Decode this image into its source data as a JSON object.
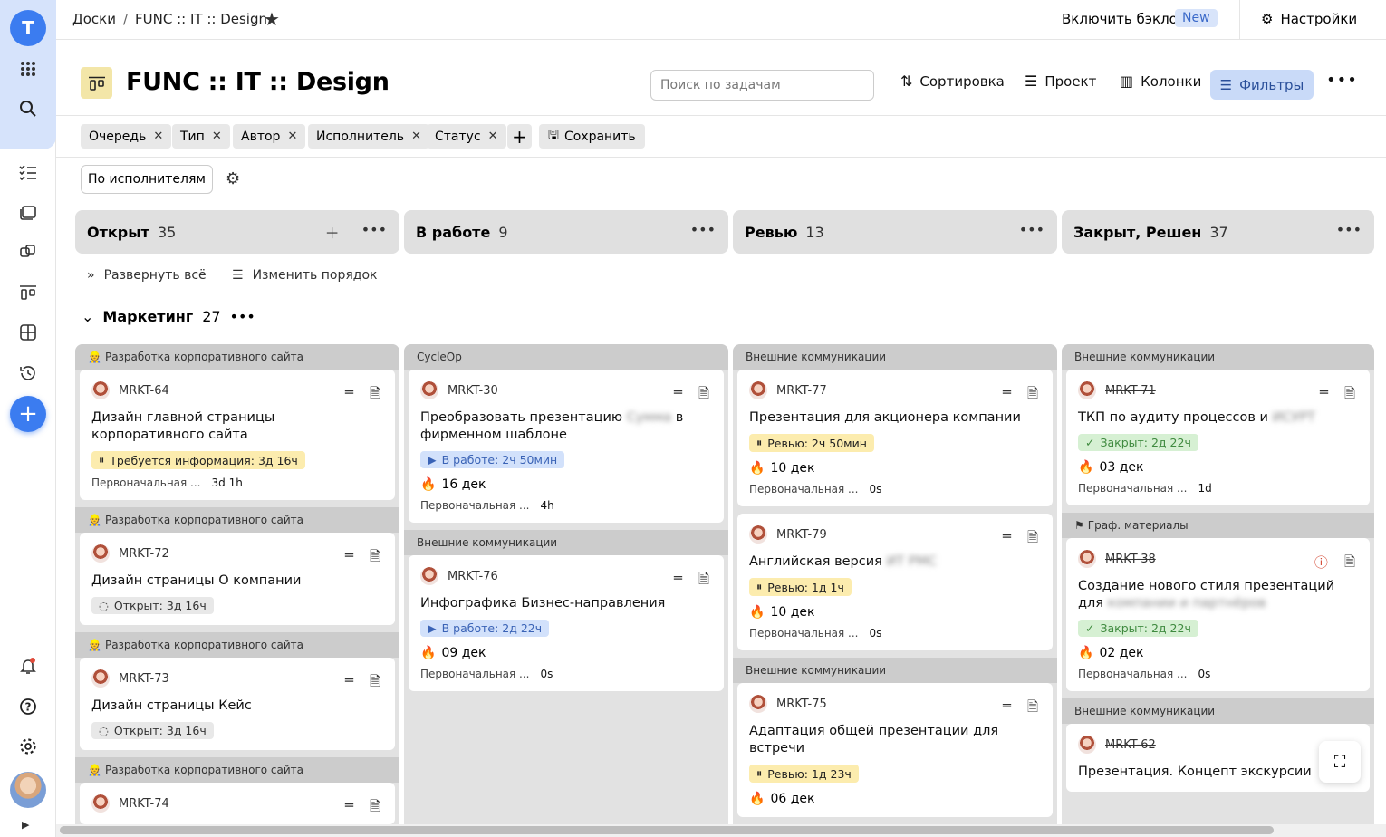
{
  "sidebar": {
    "logo": "T",
    "add_label": "+"
  },
  "breadcrumb": {
    "root": "Доски",
    "current": "FUNC :: IT :: Design"
  },
  "topbar": {
    "backlog_label": "Включить бэклог",
    "new_badge": "New",
    "settings_label": "Настройки"
  },
  "header": {
    "title": "FUNC :: IT :: Design",
    "search_placeholder": "Поиск по задачам",
    "sort_label": "Сортировка",
    "project_label": "Проект",
    "columns_label": "Колонки",
    "filters_label": "Фильтры"
  },
  "filters": {
    "chips": [
      "Очередь",
      "Тип",
      "Автор",
      "Исполнитель",
      "Статус"
    ],
    "save_label": "Сохранить"
  },
  "grouping": {
    "label": "По исполнителям"
  },
  "columns": [
    {
      "name": "Открыт",
      "count": "35"
    },
    {
      "name": "В работе",
      "count": "9"
    },
    {
      "name": "Ревью",
      "count": "13"
    },
    {
      "name": "Закрыт, Решен",
      "count": "37"
    }
  ],
  "toolbar2": {
    "expand_all": "Развернуть всё",
    "reorder": "Изменить порядок"
  },
  "swimlane": {
    "name": "Маркетинг",
    "count": "27"
  },
  "lanes": {
    "open": {
      "cards": [
        {
          "group": "Разработка корпоративного сайта",
          "key": "MRKT-64",
          "title": "Дизайн главной страницы корпоративного сайта",
          "status": "Требуется информация: 3д 16ч",
          "meta_label": "Первоначальная ...",
          "meta_value": "3d 1h"
        },
        {
          "group": "Разработка корпоративного сайта",
          "key": "MRKT-72",
          "title": "Дизайн страницы О компании",
          "status": "Открыт: 3д 16ч"
        },
        {
          "group": "Разработка корпоративного сайта",
          "key": "MRKT-73",
          "title": "Дизайн страницы Кейс",
          "status": "Открыт: 3д 16ч"
        },
        {
          "group": "Разработка корпоративного сайта",
          "key": "MRKT-74"
        }
      ]
    },
    "inprogress": {
      "cards": [
        {
          "group": "CycleOp",
          "key": "MRKT-30",
          "title": "Преобразовать презентацию",
          "title_blur": "Сумма",
          "title_tail": "в фирменном шаблоне",
          "status": "В работе: 2ч 50мин",
          "deadline": "16 дек",
          "meta_label": "Первоначальная ...",
          "meta_value": "4h"
        },
        {
          "group": "Внешние коммуникации",
          "key": "MRKT-76",
          "title": "Инфографика Бизнес-направления",
          "status": "В работе: 2д 22ч",
          "deadline": "09 дек",
          "meta_label": "Первоначальная ...",
          "meta_value": "0s"
        }
      ]
    },
    "review": {
      "cards": [
        {
          "group": "Внешние коммуникации",
          "key": "MRKT-77",
          "title": "Презентация для акционера компании",
          "status": "Ревью: 2ч 50мин",
          "deadline": "10 дек",
          "meta_label": "Первоначальная ...",
          "meta_value": "0s"
        },
        {
          "key": "MRKT-79",
          "title": "Английская версия",
          "title_blur": "ИТ РМС",
          "status": "Ревью: 1д 1ч",
          "deadline": "10 дек",
          "meta_label": "Первоначальная ...",
          "meta_value": "0s"
        },
        {
          "group": "Внешние коммуникации",
          "key": "MRKT-75",
          "title": "Адаптация общей презентации для встречи",
          "status": "Ревью: 1д 23ч",
          "deadline": "06 дек"
        }
      ]
    },
    "closed": {
      "cards": [
        {
          "group": "Внешние коммуникации",
          "key": "MRKT-71",
          "title": "ТКП по аудиту процессов и",
          "title_blur": "ИСУРТ",
          "status": "Закрыт: 2д 22ч",
          "deadline": "03 дек",
          "meta_label": "Первоначальная ...",
          "meta_value": "1d"
        },
        {
          "group": "Граф. материалы",
          "key": "MRKT-38",
          "title": "Создание нового стиля презентаций для",
          "title_blur": "компании и партнёров",
          "status": "Закрыт: 2д 22ч",
          "deadline": "02 дек",
          "meta_label": "Первоначальная ...",
          "meta_value": "0s"
        },
        {
          "group": "Внешние коммуникации",
          "key": "MRKT-62",
          "title": "Презентация. Концепт экскурсии"
        }
      ]
    }
  },
  "colors": {
    "accent": "#3b7cf0",
    "filter_active": "#c9daf8",
    "status_yellow": "#fcecae",
    "status_blue": "#d2e1fb",
    "status_green": "#d6f0d3",
    "deadline_red": "#d2412c"
  }
}
